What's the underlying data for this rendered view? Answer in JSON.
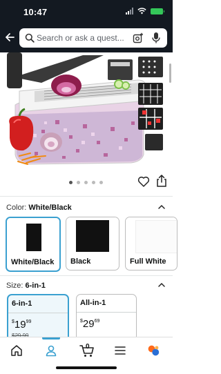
{
  "status": {
    "time": "10:47"
  },
  "search": {
    "placeholder": "Search or ask a quest..."
  },
  "gallery": {
    "dots": 5,
    "active_dot": 0
  },
  "color": {
    "label": "Color:",
    "selected": "White/Black",
    "options": [
      {
        "label": "White/Black",
        "swatch": "#ffffff",
        "accent": "#111111",
        "selected": true
      },
      {
        "label": "Black",
        "swatch": "#111111",
        "selected": false
      },
      {
        "label": "Full White",
        "swatch": "#ffffff",
        "selected": false
      }
    ]
  },
  "size": {
    "label": "Size:",
    "selected": "6-in-1",
    "options": [
      {
        "label": "6-in-1",
        "price_dollars": "19",
        "price_cents": "99",
        "list_price": "$29.99",
        "selected": true
      },
      {
        "label": "All-in-1",
        "price_dollars": "29",
        "price_cents": "69",
        "selected": false
      }
    ]
  },
  "nav": {
    "items": [
      "home-icon",
      "account-icon",
      "cart-icon",
      "menu-icon",
      "rufus-icon"
    ],
    "active": 1,
    "cart_count": "0"
  },
  "colors": {
    "header_bg": "#131921",
    "accent_blue": "#3aa0d0",
    "battery_green": "#34c759"
  }
}
